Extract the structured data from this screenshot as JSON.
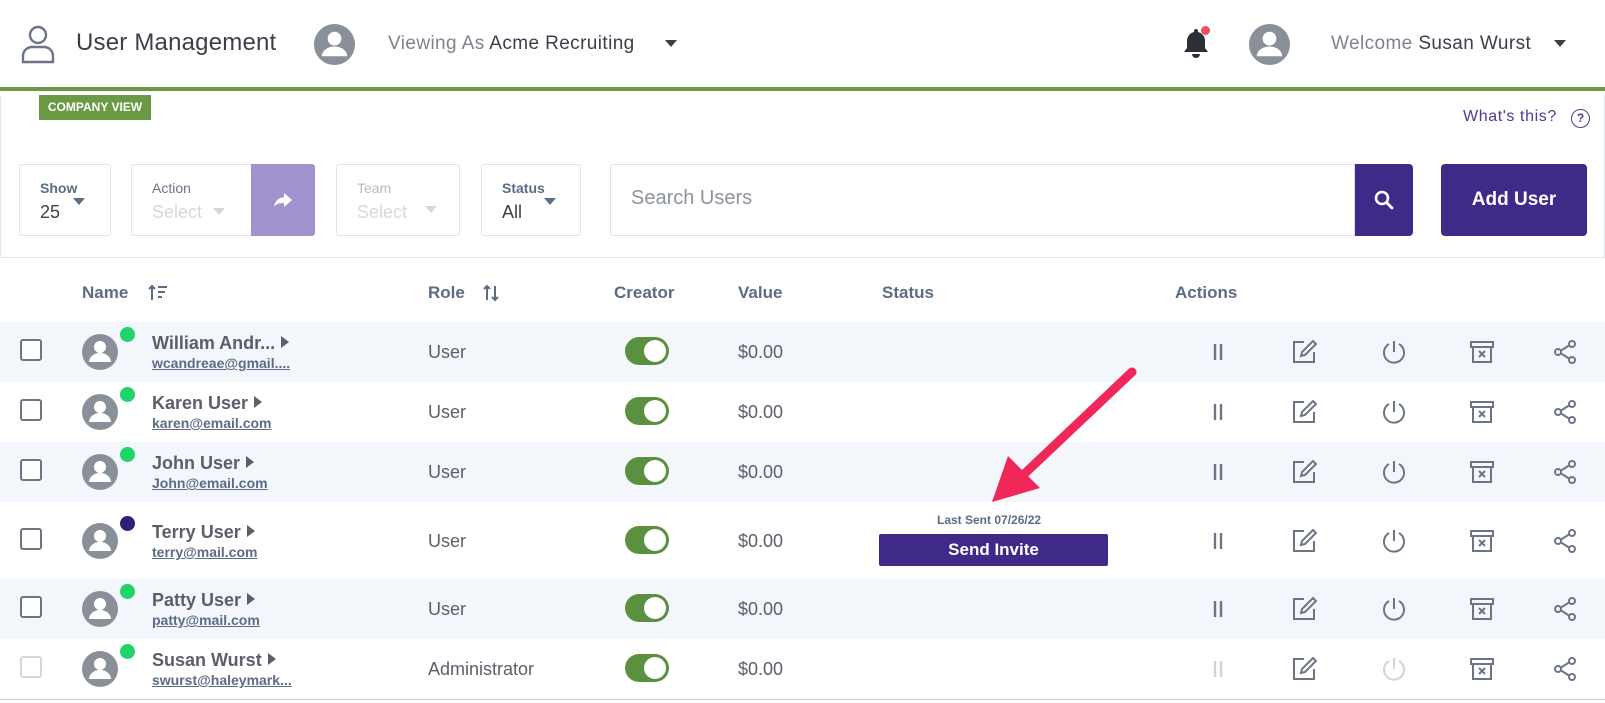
{
  "header": {
    "title": "User Management",
    "viewing_prefix": "Viewing As",
    "viewing_value": "Acme Recruiting",
    "welcome_prefix": "Welcome",
    "welcome_name": "Susan Wurst"
  },
  "panel": {
    "badge": "COMPANY VIEW",
    "whats_this": "What's this?",
    "help_glyph": "?",
    "show": {
      "label": "Show",
      "value": "25"
    },
    "action": {
      "label": "Action",
      "value": "Select"
    },
    "team": {
      "label": "Team",
      "value": "Select"
    },
    "status": {
      "label": "Status",
      "value": "All"
    },
    "search_placeholder": "Search Users",
    "add_user": "Add User"
  },
  "table": {
    "headers": {
      "name": "Name",
      "role": "Role",
      "creator": "Creator",
      "value": "Value",
      "status": "Status",
      "actions": "Actions"
    },
    "rows": [
      {
        "name": "William Andr...",
        "email": "wcandreae@gmail....",
        "role": "User",
        "value": "$0.00"
      },
      {
        "name": "Karen User",
        "email": "karen@email.com",
        "role": "User",
        "value": "$0.00"
      },
      {
        "name": "John User",
        "email": "John@email.com",
        "role": "User",
        "value": "$0.00"
      },
      {
        "name": "Terry User",
        "email": "terry@mail.com",
        "role": "User",
        "value": "$0.00",
        "last_sent": "Last Sent 07/26/22",
        "invite": "Send Invite"
      },
      {
        "name": "Patty User",
        "email": "patty@mail.com",
        "role": "User",
        "value": "$0.00"
      },
      {
        "name": "Susan Wurst",
        "email": "swurst@haleymark...",
        "role": "Administrator",
        "value": "$0.00"
      }
    ]
  },
  "colors": {
    "brand": "#3f2a87",
    "accent_green": "#6a9a45",
    "online": "#21d36b",
    "annotation_arrow": "#f0285a"
  },
  "icons": [
    "user-outline-icon",
    "avatar-icon",
    "caret-down-icon",
    "bell-icon",
    "share-arrow-icon",
    "search-icon",
    "sort-icon",
    "pause-icon",
    "edit-icon",
    "power-icon",
    "archive-icon",
    "share-icon"
  ]
}
